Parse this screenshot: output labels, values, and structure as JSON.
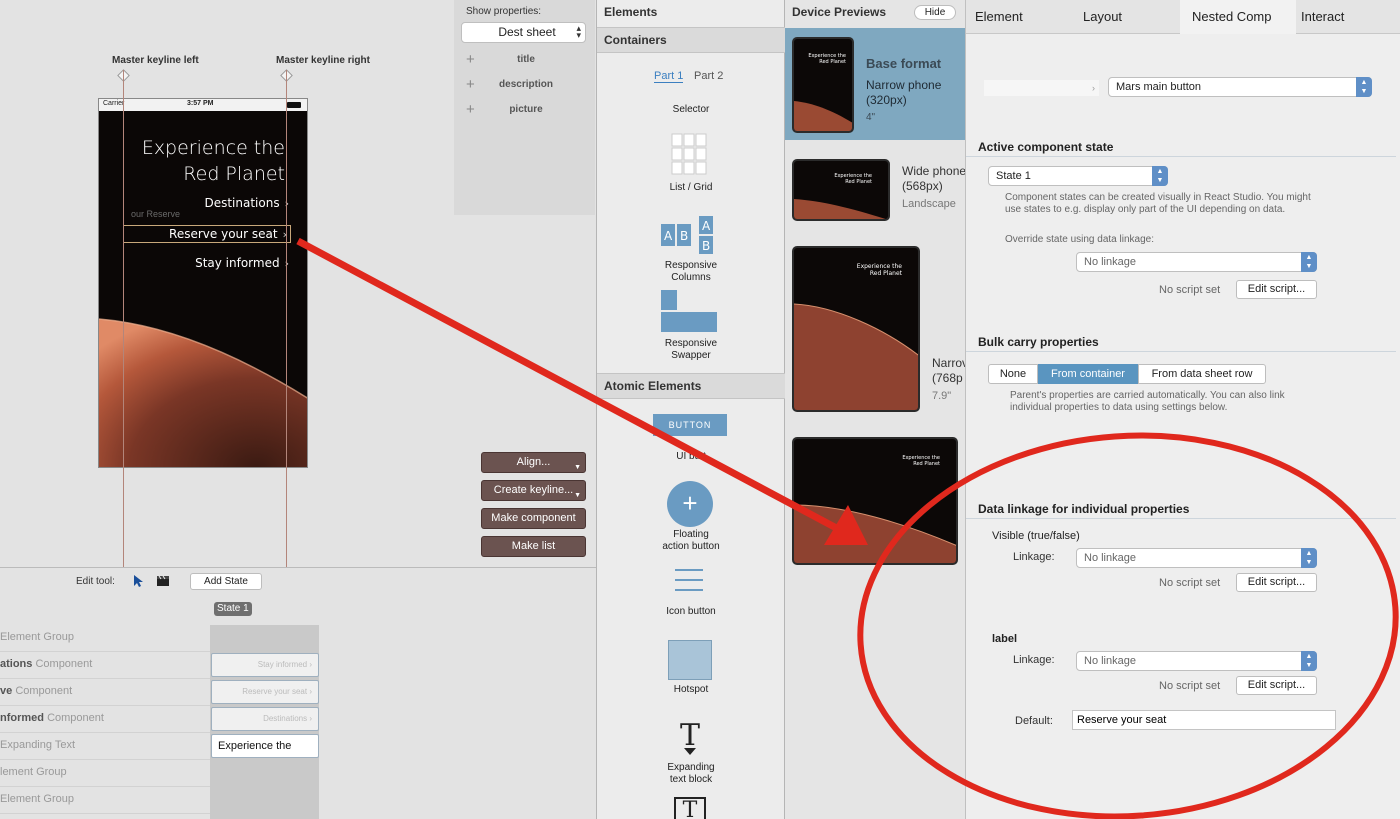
{
  "canvas": {
    "keyline_left_label": "Master keyline left",
    "keyline_right_label": "Master keyline right",
    "phone": {
      "carrier": "Carrier",
      "time": "3:57 PM",
      "title_line1": "Experience the",
      "title_line2": "Red Planet",
      "items": [
        "Destinations",
        "Reserve your seat",
        "Stay informed"
      ],
      "ghost_text": "our Reserve"
    }
  },
  "show_properties": {
    "label": "Show properties:",
    "sheet": "Dest sheet",
    "props": [
      "title",
      "description",
      "picture"
    ]
  },
  "canvas_buttons": [
    "Align...",
    "Create keyline...",
    "Make component",
    "Make list"
  ],
  "states": {
    "edit_tool_label": "Edit tool:",
    "add_state": "Add State",
    "state_badge": "State 1",
    "rows": [
      {
        "name": "",
        "kind": "Element Group"
      },
      {
        "name": "ations",
        "kind": "Component"
      },
      {
        "name": "ve",
        "kind": "Component"
      },
      {
        "name": "nformed",
        "kind": "Component"
      },
      {
        "name": "",
        "kind": "Expanding Text"
      },
      {
        "name": "",
        "kind": "lement Group"
      },
      {
        "name": "",
        "kind": "Element Group"
      }
    ],
    "cells": [
      "Stay informed",
      "Reserve your seat",
      "Destinations",
      "Experience the"
    ]
  },
  "elements_panel": {
    "title": "Elements",
    "containers": "Containers",
    "part1": "Part 1",
    "part2": "Part 2",
    "selector": "Selector",
    "list_grid": "List / Grid",
    "responsive_columns_1": "Responsive",
    "responsive_columns_2": "Columns",
    "responsive_swapper_1": "Responsive",
    "responsive_swapper_2": "Swapper",
    "atomic": "Atomic Elements",
    "button_chip": "BUTTON",
    "ui_button": "UI butt",
    "fab_1": "Floating",
    "fab_2": "action button",
    "icon_button": "Icon button",
    "hotspot": "Hotspot",
    "expanding_1": "Expanding",
    "expanding_2": "text block"
  },
  "device_previews": {
    "title": "Device Previews",
    "hide": "Hide",
    "base_format": "Base format",
    "narrow_phone": "Narrow phone",
    "narrow_px": "(320px)",
    "narrow_size": "4\"",
    "wide_phone": "Wide phone",
    "wide_px": "(568px)",
    "landscape": "Landscape",
    "narrow_tablet": "Narrov",
    "tablet_px": "(768p",
    "tablet_size": "7.9\""
  },
  "inspector": {
    "tabs": [
      "Element",
      "Layout",
      "Nested Comp",
      "Interact"
    ],
    "active_tab": "Nested Comp",
    "component_select": "Mars main button",
    "active_state_heading": "Active component state",
    "state_select": "State 1",
    "state_help": "Component states can be created visually in React Studio. You might use states to e.g. display only part of the UI depending on data.",
    "override_label": "Override state using data linkage:",
    "no_linkage": "No linkage",
    "no_script": "No script set",
    "edit_script": "Edit script...",
    "bulk_heading": "Bulk carry properties",
    "bulk_options": [
      "None",
      "From container",
      "From data sheet row"
    ],
    "bulk_selected": "From container",
    "bulk_help": "Parent's properties are carried automatically. You can also link individual properties to data using settings below.",
    "linkage_heading": "Data linkage for individual properties",
    "visible_label": "Visible (true/false)",
    "linkage_label": "Linkage:",
    "label_prop": "label",
    "default_label": "Default:",
    "default_value": "Reserve your seat"
  },
  "colors": {
    "accent_red": "#e0281d",
    "selected_blue": "#5a95c0",
    "select_arrow": "#5f8fc7",
    "tablet_highlight": "#7fa8c0"
  }
}
